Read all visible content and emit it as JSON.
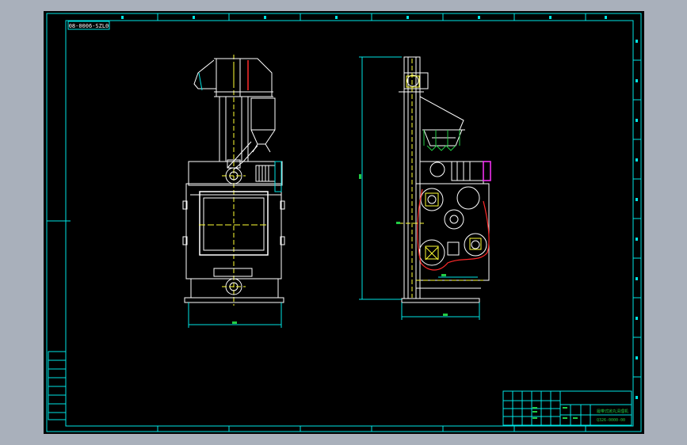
{
  "drawing": {
    "code_box": "08-0006-SZL0",
    "title_block": {
      "name": "履带式抛丸清理机",
      "code": "Q326-0000-00"
    },
    "colors": {
      "background": "#000000",
      "frame": "#00e5e5",
      "outline": "#ffffff",
      "centerline": "#ffff33",
      "highlight": "#ff2a2a",
      "accent": "#ff33ff",
      "dimension": "#22cc44"
    }
  }
}
